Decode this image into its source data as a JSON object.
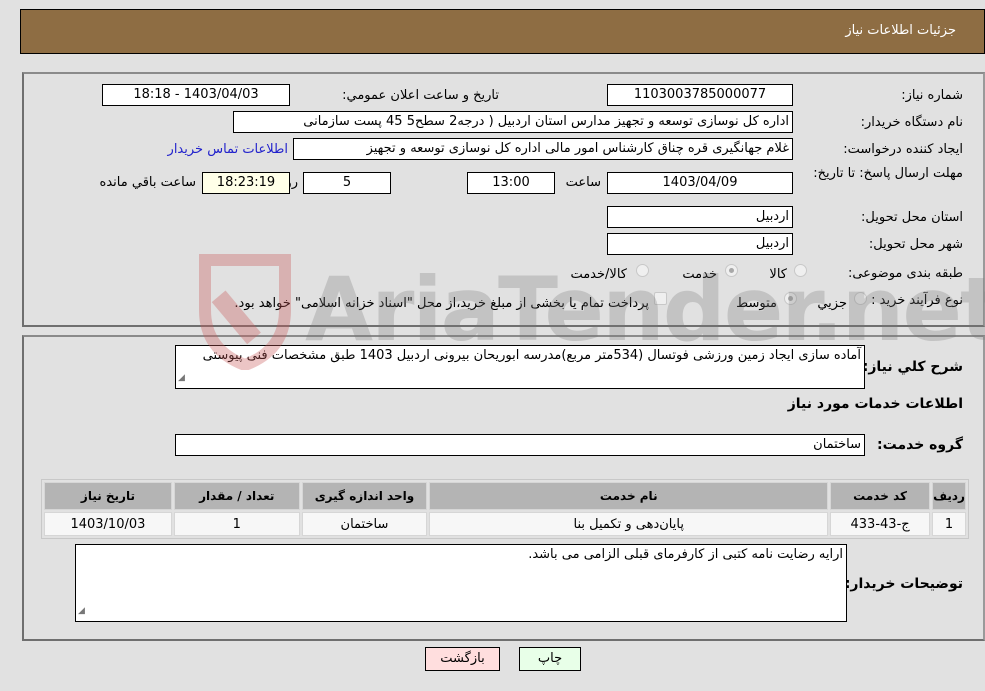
{
  "header": {
    "title": "جزئیات اطلاعات نیاز"
  },
  "details": {
    "need_number": {
      "label": "شماره نیاز:",
      "value": "1103003785000077"
    },
    "announce": {
      "label": "تاریخ و ساعت اعلان عمومي:",
      "value": "1403/04/03 - 18:18"
    },
    "buyer_org": {
      "label": "نام دستگاه خریدار:",
      "value": "اداره کل نوسازی   توسعه و تجهیز مدارس استان اردبیل ( درجه2  سطح5  45 پست سازمانی"
    },
    "requester": {
      "label": "ایجاد کننده درخواست:",
      "value": "غلام جهانگیری قره چناق کارشناس امور مالی اداره کل نوسازی   توسعه و تجهیز",
      "contact_link": "اطلاعات تماس خریدار"
    },
    "deadline": {
      "label": "مهلت ارسال پاسخ: تا تاریخ:",
      "date": "1403/04/09",
      "time_label": "ساعت",
      "time": "13:00",
      "days": "5",
      "days_label": "روز و",
      "remaining": "18:23:19",
      "remaining_label": "ساعت باقي مانده"
    },
    "province": {
      "label": "استان محل تحویل:",
      "value": "اردبیل"
    },
    "city": {
      "label": "شهر محل تحویل:",
      "value": "اردبیل"
    },
    "category": {
      "label": "طبقه بندی موضوعی:",
      "options": [
        {
          "label": "کالا",
          "checked": false
        },
        {
          "label": "خدمت",
          "checked": true
        },
        {
          "label": "کالا/خدمت",
          "checked": false
        }
      ]
    },
    "purchase_type": {
      "label": "نوع فرآیند خرید :",
      "options": [
        {
          "label": "جزيي",
          "checked": false
        },
        {
          "label": "متوسط",
          "checked": true
        }
      ],
      "treasury_note": "پرداخت تمام یا بخشی از مبلغ خرید،از محل \"اسناد خزانه اسلامی\" خواهد بود.",
      "treasury_checked": false
    }
  },
  "summary": {
    "label": "شرح کلي نیاز:",
    "value": "آماده سازی ایجاد زمین ورزشی فوتسال (534متر مربع)مدرسه ابوریحان بیرونی اردبیل 1403 طبق مشخصات فنی پیوستی"
  },
  "services": {
    "section_title": "اطلاعات خدمات مورد نیاز",
    "group_label": "گروه خدمت:",
    "group_value": "ساختمان",
    "columns": [
      "ردیف",
      "کد خدمت",
      "نام خدمت",
      "واحد اندازه گیری",
      "تعداد / مقدار",
      "تاریخ نیاز"
    ],
    "rows": [
      [
        "1",
        "ج-43-433",
        "پایان‌دهی و تکمیل بنا",
        "ساختمان",
        "1",
        "1403/10/03"
      ]
    ]
  },
  "buyer_notes": {
    "label": "توضیحات خریدار:",
    "value": "ارایه رضایت نامه کتبی از کارفرمای قبلی الزامی می باشد."
  },
  "buttons": {
    "print": "چاپ",
    "back": "بازگشت"
  },
  "watermark": {
    "text": "AriaTender.net"
  }
}
